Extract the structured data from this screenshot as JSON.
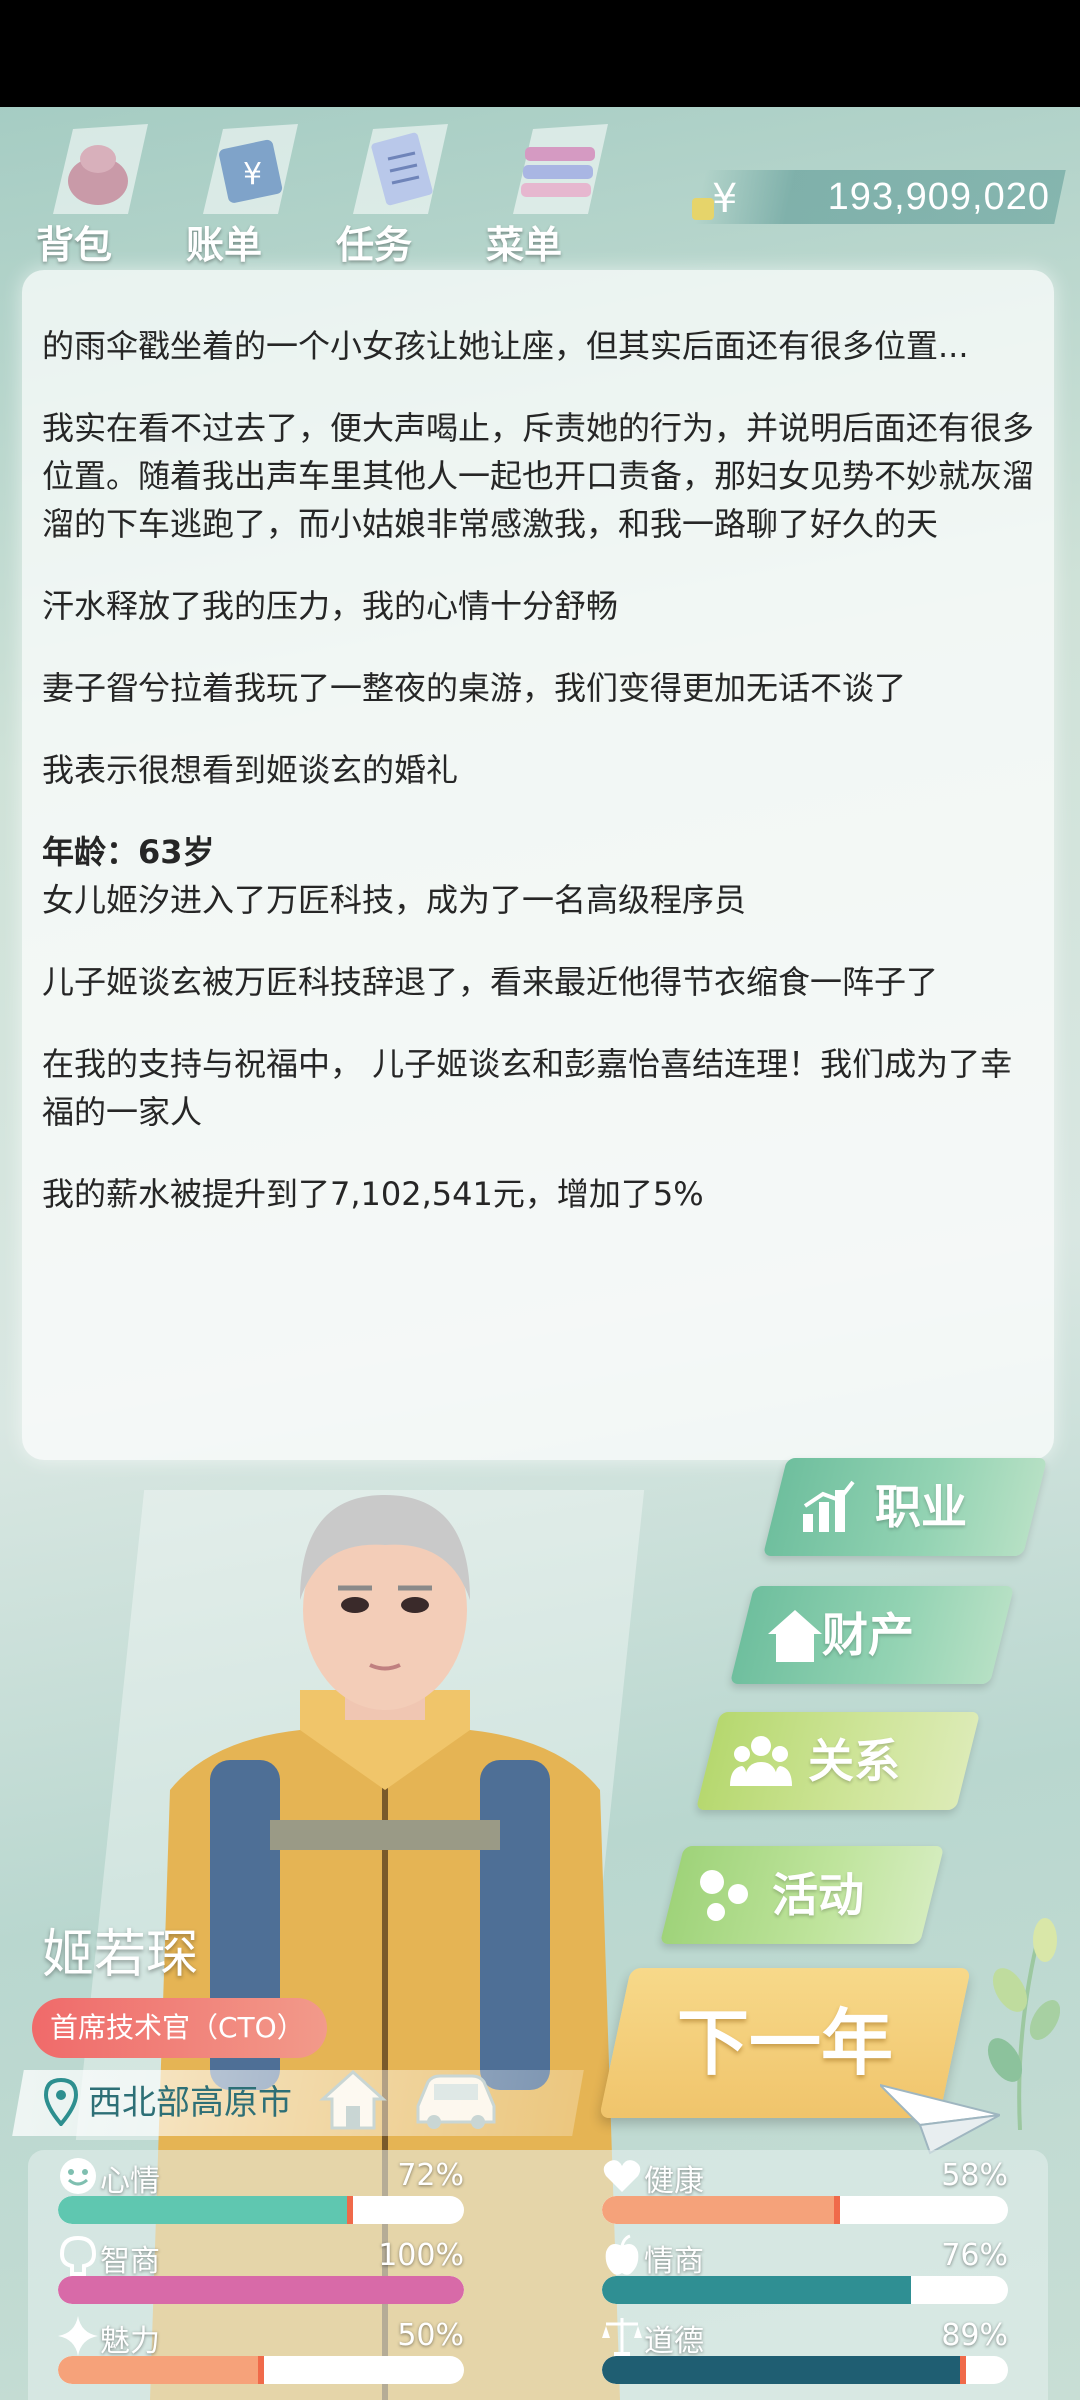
{
  "nav": {
    "items": [
      {
        "label": "背包",
        "icon": "backpack-icon"
      },
      {
        "label": "账单",
        "icon": "bill-icon"
      },
      {
        "label": "任务",
        "icon": "task-icon"
      },
      {
        "label": "菜单",
        "icon": "menu-icon"
      }
    ],
    "money": "193,909,020"
  },
  "story": {
    "paragraphs_before": [
      "的雨伞戳坐着的一个小女孩让她让座，但其实后面还有很多位置...",
      "我实在看不过去了，便大声喝止，斥责她的行为，并说明后面还有很多位置。随着我出声车里其他人一起也开口责备，那妇女见势不妙就灰溜溜的下车逃跑了，而小姑娘非常感激我，和我一路聊了好久的天",
      "汗水释放了我的压力，我的心情十分舒畅",
      "妻子眢兮拉着我玩了一整夜的桌游，我们变得更加无话不谈了",
      "我表示很想看到姬谈玄的婚礼"
    ],
    "age": "年龄：63岁",
    "paragraphs_after": [
      "女儿姬汐进入了万匠科技，成为了一名高级程序员",
      "儿子姬谈玄被万匠科技辞退了，看来最近他得节衣缩食一阵子了",
      "在我的支持与祝福中， 儿子姬谈玄和彭嘉怡喜结连理！我们成为了幸福的一家人",
      "我的薪水被提升到了7,102,541元，增加了5%"
    ]
  },
  "actions": {
    "career": "职业",
    "property": "财产",
    "relations": "关系",
    "activity": "活动",
    "next_year": "下一年"
  },
  "character": {
    "name": "姬若琛",
    "job": "首席技术官（CTO）",
    "location": "西北部高原市"
  },
  "stats": [
    {
      "label": "心情",
      "value": "72%",
      "fill": 0.72,
      "color": "#5fc7b0",
      "icon": "smile-icon"
    },
    {
      "label": "健康",
      "value": "58%",
      "fill": 0.58,
      "color": "#f5a27a",
      "icon": "heart-icon"
    },
    {
      "label": "智商",
      "value": "100%",
      "fill": 1.0,
      "color": "#d86aa8",
      "icon": "brain-icon"
    },
    {
      "label": "情商",
      "value": "76%",
      "fill": 0.76,
      "color": "#2f8f93",
      "icon": "apple-icon"
    },
    {
      "label": "魅力",
      "value": "50%",
      "fill": 0.5,
      "color": "#f6a27a",
      "icon": "sparkle-icon"
    },
    {
      "label": "道德",
      "value": "89%",
      "fill": 0.89,
      "color": "#1f5e72",
      "icon": "scale-icon"
    }
  ],
  "colors": {
    "accent_green": "#6fbf9e",
    "next_year_gold": "#f0c46b",
    "job_badge": "#f06a6a",
    "location_text": "#2d6f76"
  }
}
